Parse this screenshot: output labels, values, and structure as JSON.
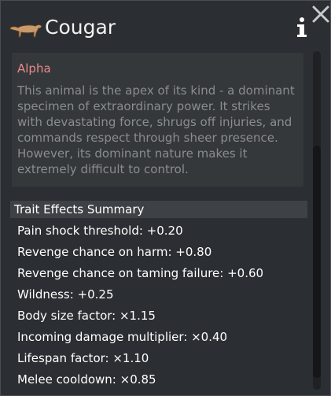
{
  "header": {
    "title": "Cougar"
  },
  "trait": {
    "name": "Alpha",
    "description": "This animal is the apex of its kind - a dominant specimen of extraordinary power. It strikes with devastating force, shrugs off injuries, and commands respect through sheer presence. However, its dominant nature makes it extremely difficult to control."
  },
  "summary": {
    "header": "Trait Effects Summary",
    "effects": [
      "Pain shock threshold: +0.20",
      "Revenge chance on harm: +0.80",
      "Revenge chance on taming failure: +0.60",
      "Wildness: +0.25",
      "Body size factor: ×1.15",
      "Incoming damage multiplier: ×0.40",
      "Lifespan factor: ×1.10",
      "Melee cooldown: ×0.85"
    ]
  },
  "icons": {
    "animal": "cougar-icon",
    "info": "info-icon",
    "close": "close-icon"
  },
  "colors": {
    "trait_title": "#e88a8a",
    "panel_bg": "#2b2e32"
  }
}
